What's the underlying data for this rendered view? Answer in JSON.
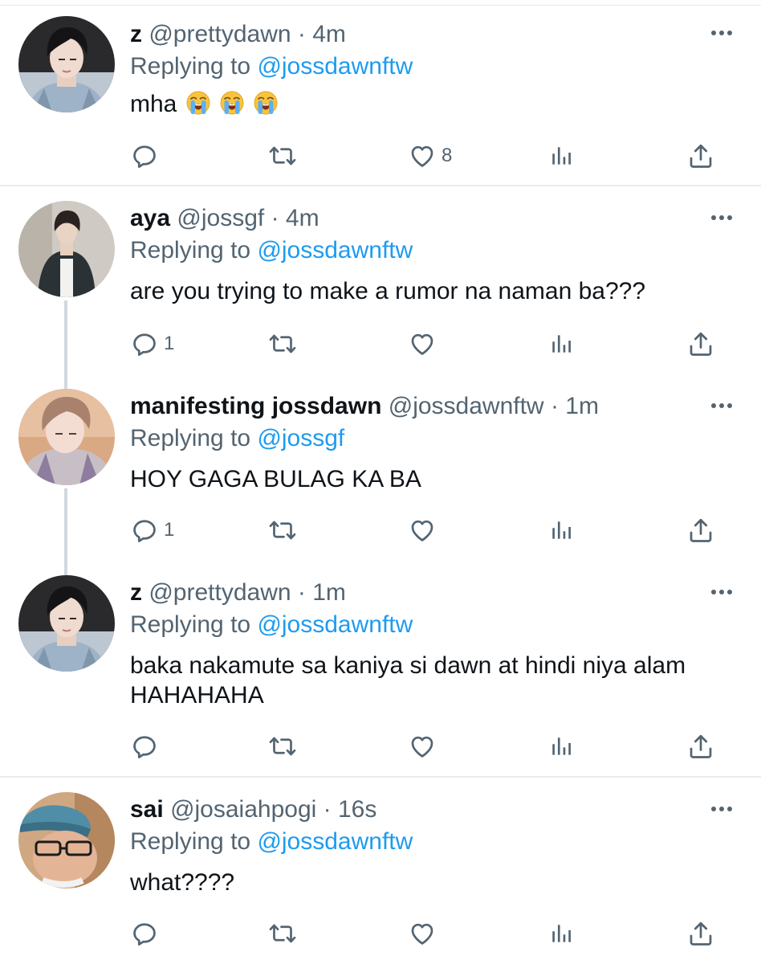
{
  "tweets": [
    {
      "name": "z",
      "handle": "@prettydawn",
      "dot": "·",
      "time": "4m",
      "replying_label": "Replying to",
      "replying_to": "@jossdawnftw",
      "text": "mha",
      "emojis": [
        "loudly-crying-face",
        "loudly-crying-face",
        "loudly-crying-face"
      ],
      "reply_count": "",
      "like_count": "8"
    },
    {
      "name": "aya",
      "handle": "@jossgf",
      "dot": "·",
      "time": "4m",
      "replying_label": "Replying to",
      "replying_to": "@jossdawnftw",
      "text": "are you trying to make a rumor na naman ba???",
      "reply_count": "1",
      "like_count": ""
    },
    {
      "name": "manifesting jossdawn",
      "handle": "@jossdawnftw",
      "dot": "·",
      "time": "1m",
      "replying_label": "Replying to",
      "replying_to": "@jossgf",
      "text": "HOY GAGA BULAG KA BA",
      "reply_count": "1",
      "like_count": ""
    },
    {
      "name": "z",
      "handle": "@prettydawn",
      "dot": "·",
      "time": "1m",
      "replying_label": "Replying to",
      "replying_to": "@jossdawnftw",
      "text": "baka nakamute sa kaniya si dawn at hindi niya alam HAHAHAHA",
      "reply_count": "",
      "like_count": ""
    },
    {
      "name": "sai",
      "handle": "@josaiahpogi",
      "dot": "·",
      "time": "16s",
      "replying_label": "Replying to",
      "replying_to": "@jossdawnftw",
      "text": "what????",
      "reply_count": "",
      "like_count": ""
    }
  ],
  "icons": {
    "reply": "reply-icon",
    "retweet": "retweet-icon",
    "like": "heart-icon",
    "views": "analytics-icon",
    "share": "share-icon",
    "more": "more-icon"
  },
  "colors": {
    "mention": "#1d9bf0",
    "secondary_text": "#536471",
    "primary_text": "#0f1419",
    "divider": "#e6ecf0",
    "thread_line": "#cfd9de"
  }
}
